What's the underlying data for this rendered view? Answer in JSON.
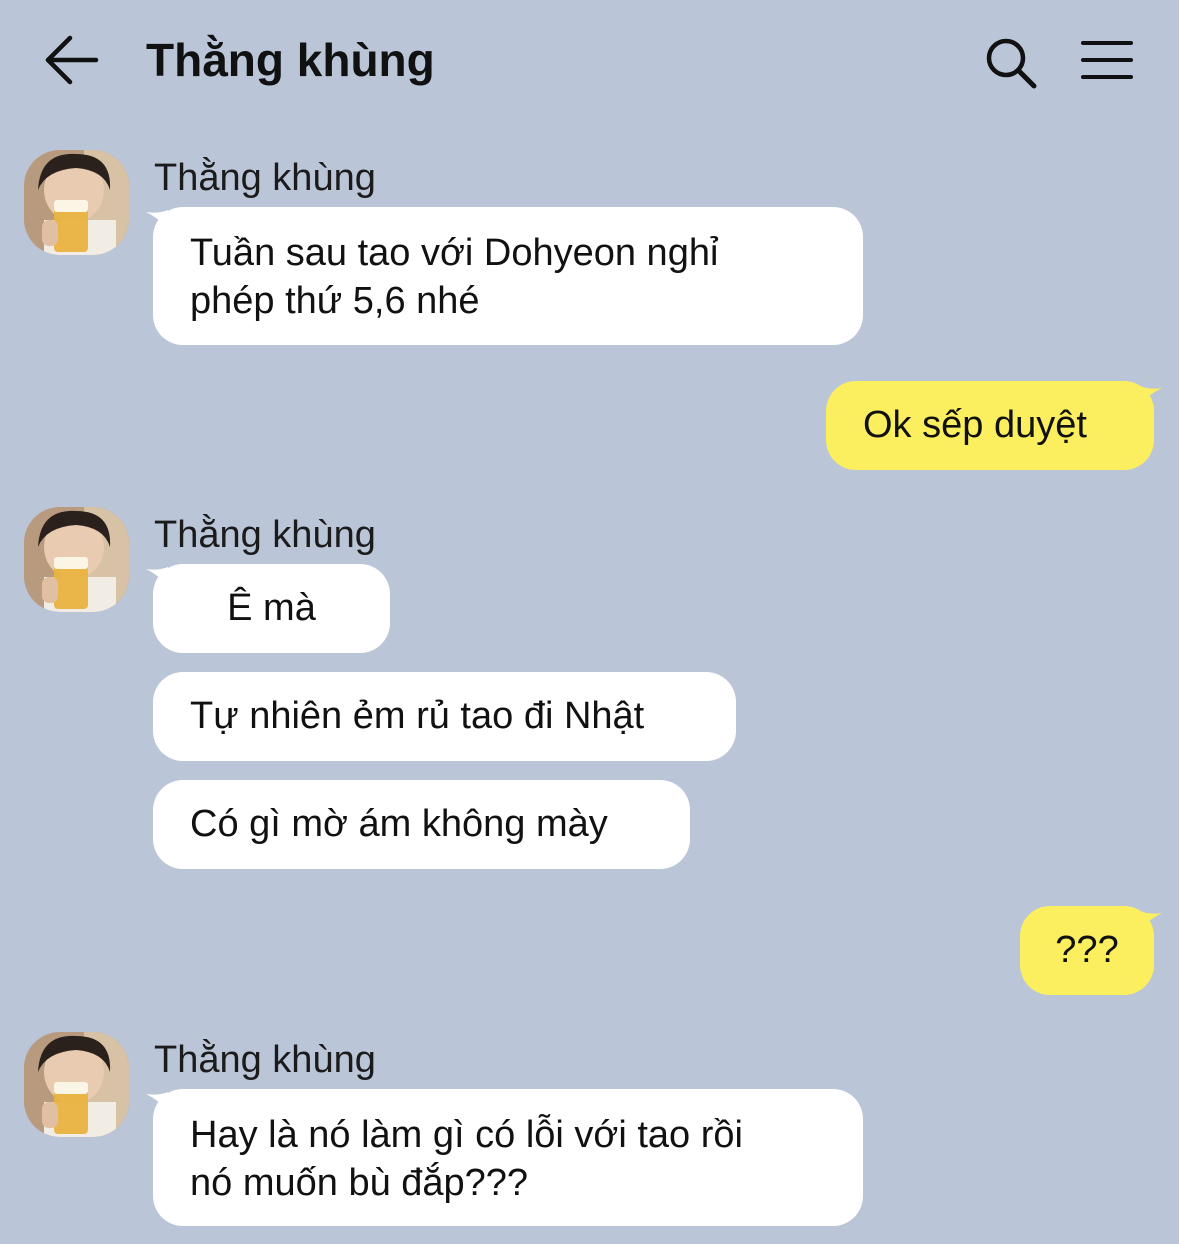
{
  "header": {
    "title": "Thằng khùng"
  },
  "icons": {
    "back": "arrow-left-icon",
    "search": "search-icon",
    "menu": "hamburger-menu-icon",
    "avatar": "avatar-photo"
  },
  "colors": {
    "background": "#bac5d8",
    "incoming_bubble": "#ffffff",
    "outgoing_bubble": "#fbee5f"
  },
  "messages": [
    {
      "from": "incoming",
      "sender": "Thằng khùng",
      "text_line1": "Tuần sau tao với Dohyeon nghỉ",
      "text_line2": "phép thứ 5,6 nhé"
    },
    {
      "from": "outgoing",
      "text": "Ok sếp duyệt"
    },
    {
      "from": "incoming",
      "sender": "Thằng khùng",
      "text": "Ê mà"
    },
    {
      "from": "incoming",
      "text": "Tự nhiên ẻm rủ tao đi Nhật"
    },
    {
      "from": "incoming",
      "text": "Có gì mờ ám không mày"
    },
    {
      "from": "outgoing",
      "text": "???"
    },
    {
      "from": "incoming",
      "sender": "Thằng khùng",
      "text_line1": "Hay là nó làm gì có lỗi với tao rồi",
      "text_line2": "nó muốn bù đắp???"
    }
  ]
}
